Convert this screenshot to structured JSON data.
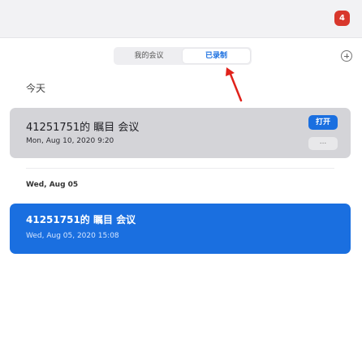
{
  "topbar": {
    "badge_count": "4"
  },
  "tabs": [
    {
      "label": "我的会议",
      "selected": false
    },
    {
      "label": "已录制",
      "selected": true
    }
  ],
  "recordings": {
    "today_section": {
      "heading": "今天",
      "items": [
        {
          "title": "41251751的 瞩目 会议",
          "datetime": "Mon, Aug 10, 2020 9:20",
          "open_label": "打开",
          "more_label": "..."
        }
      ]
    },
    "earlier_section": {
      "heading": "Wed, Aug 05",
      "items": [
        {
          "title": "41251751的 瞩目 会议",
          "datetime": "Wed, Aug 05, 2020 15:08"
        }
      ]
    }
  },
  "colors": {
    "accent": "#1a6fe0",
    "badge": "#d8372c",
    "annotation_arrow": "#e0221b"
  }
}
